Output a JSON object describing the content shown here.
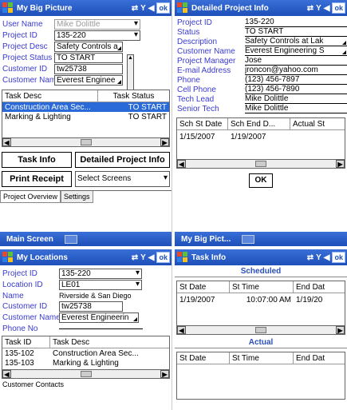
{
  "status_icons": {
    "connectivity": "⇄",
    "signal": "Y",
    "volume": "◀",
    "ok": "ok"
  },
  "colors": {
    "title_bar": "#1d4fb8",
    "label": "#3a3ad0",
    "selection": "#2a6ad8"
  },
  "screen1": {
    "title": "My Big Picture",
    "fields": [
      {
        "label": "User Name",
        "value": "Mike Dolittle",
        "type": "disabled-dropdown"
      },
      {
        "label": "Project ID",
        "value": "135-220",
        "type": "dropdown"
      },
      {
        "label": "Project Desc",
        "value": "Safety Controls a",
        "type": "text"
      },
      {
        "label": "Project Status",
        "value": "TO START",
        "type": "text"
      },
      {
        "label": "Customer ID",
        "value": "tw25738",
        "type": "text"
      },
      {
        "label": "Customer Name",
        "value": "Everest Enginee",
        "type": "text"
      }
    ],
    "grid": {
      "headers": [
        "Task Desc",
        "Task Status"
      ],
      "rows": [
        [
          "Construction Area Sec...",
          "TO START"
        ],
        [
          "Marking & Lighting",
          "TO START"
        ]
      ]
    },
    "buttons": {
      "task_info": "Task Info",
      "detailed_project_info": "Detailed Project Info",
      "print_receipt": "Print Receipt"
    },
    "select_screens": "Select Screens",
    "tabs": [
      "Project Overview",
      "Settings"
    ],
    "menu": "Main Screen"
  },
  "screen2": {
    "title": "Detailed Project Info",
    "fields": [
      {
        "label": "Project ID",
        "value": "135-220"
      },
      {
        "label": "Status",
        "value": "TO START"
      },
      {
        "label": "Description",
        "value": "Safety Controls at Lak"
      },
      {
        "label": "Customer Name",
        "value": "Everest Engineering S"
      },
      {
        "label": "Project Manager",
        "value": "Jose"
      },
      {
        "label": "E-mail Address",
        "value": "jroncon@yahoo.com"
      },
      {
        "label": "Phone",
        "value": "(123) 456-7897"
      },
      {
        "label": "Cell Phone",
        "value": "(123) 456-7890"
      },
      {
        "label": "Tech Lead",
        "value": "Mike Dolittle"
      },
      {
        "label": "Senior Tech",
        "value": "Mike Dolittle"
      }
    ],
    "grid": {
      "headers": [
        "Sch St Date",
        "Sch End D...",
        "Actual St"
      ],
      "rows": [
        [
          "1/15/2007",
          "1/19/2007",
          ""
        ]
      ]
    },
    "ok_button": "OK",
    "menu": "My Big Pict..."
  },
  "screen3": {
    "title": "My Locations",
    "fields": [
      {
        "label": "Project ID",
        "value": "135-220",
        "type": "dropdown"
      },
      {
        "label": "Location ID",
        "value": "LE01",
        "type": "dropdown"
      },
      {
        "label": "Name",
        "value": "Riverside & San Diego",
        "type": "plain"
      },
      {
        "label": "Customer ID",
        "value": "tw25738",
        "type": "text"
      },
      {
        "label": "Customer Name",
        "value": "Everest Engineerin",
        "type": "text"
      },
      {
        "label": "Phone No",
        "value": "",
        "type": "plain"
      }
    ],
    "grid": {
      "headers": [
        "Task ID",
        "Task Desc"
      ],
      "rows": [
        [
          "135-102",
          "Construction Area Sec..."
        ],
        [
          "135-103",
          "Marking & Lighting"
        ]
      ]
    },
    "footer": "Customer Contacts"
  },
  "screen4": {
    "title": "Task Info",
    "scheduled": {
      "title": "Scheduled",
      "headers": [
        "St Date",
        "St Time",
        "End Dat"
      ],
      "rows": [
        [
          "1/19/2007",
          "10:07:00 AM",
          "1/19/20"
        ]
      ]
    },
    "actual": {
      "title": "Actual",
      "headers": [
        "St Date",
        "St Time",
        "End Dat"
      ]
    }
  }
}
